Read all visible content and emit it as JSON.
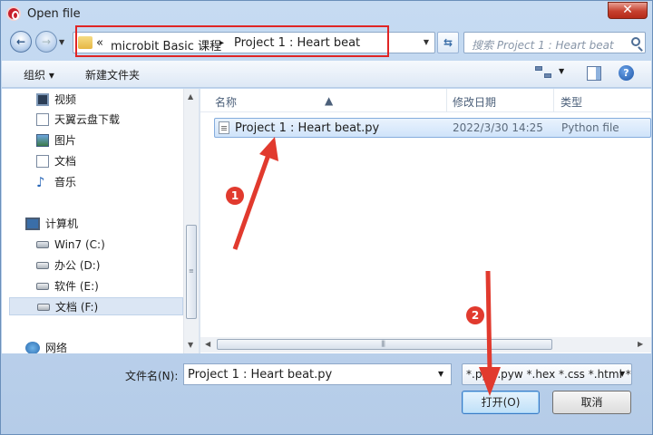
{
  "window": {
    "title": "Open file",
    "close_symbol": "✕"
  },
  "address": {
    "crumbs": [
      "microbit Basic 课程",
      "Project 1 : Heart beat"
    ],
    "overflow": "«",
    "separator": "▸"
  },
  "search": {
    "placeholder": "搜索 Project 1 : Heart beat"
  },
  "toolbar": {
    "organize": "组织 ▾",
    "new_folder": "新建文件夹",
    "help": "?"
  },
  "nav": {
    "items": [
      {
        "label": "视频",
        "icon": "video-library-icon"
      },
      {
        "label": "天翼云盘下载",
        "icon": "download-folder-icon"
      },
      {
        "label": "图片",
        "icon": "pictures-library-icon"
      },
      {
        "label": "文档",
        "icon": "documents-library-icon"
      },
      {
        "label": "音乐",
        "icon": "music-library-icon"
      }
    ],
    "computer": "计算机",
    "drives": [
      {
        "label": "Win7 (C:)",
        "icon": "system-drive-icon"
      },
      {
        "label": "办公 (D:)",
        "icon": "drive-icon"
      },
      {
        "label": "软件 (E:)",
        "icon": "drive-icon"
      },
      {
        "label": "文档 (F:)",
        "icon": "drive-icon"
      }
    ],
    "network": "网络"
  },
  "columns": {
    "name": "名称",
    "modified": "修改日期",
    "type": "类型"
  },
  "files": [
    {
      "name": "Project 1 : Heart beat.py",
      "modified": "2022/3/30 14:25",
      "type": "Python file"
    }
  ],
  "bottom": {
    "filename_label": "文件名(N):",
    "filename_value": "Project 1 : Heart beat.py",
    "filetype_value": "*.py *.pyw *.hex *.css *.html *",
    "open_label": "打开(O)",
    "cancel_label": "取消"
  },
  "annotations": {
    "step1": "1",
    "step2": "2",
    "color": "#e13a2e"
  }
}
